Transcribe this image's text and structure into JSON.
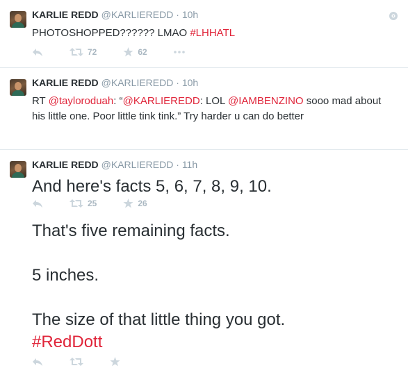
{
  "tweets": [
    {
      "name": "KARLIE REDD",
      "handle": "@KARLIEREDD",
      "separator": "·",
      "time": "10h",
      "text_before": "PHOTOSHOPPED?????? LMAO ",
      "hashtag": "#LHHATL",
      "retweets": "72",
      "favorites": "62"
    },
    {
      "name": "KARLIE REDD",
      "handle": "@KARLIEREDD",
      "separator": "·",
      "time": "10h",
      "prefix": "RT ",
      "mention1": "@tayloroduah",
      "part2": ": “",
      "mention2": "@KARLIEREDD",
      "part3": ": LOL ",
      "mention3": "@IAMBENZINO",
      "part4": " sooo mad about his little one. Poor little tink tink.” Try harder u can do better",
      "retweets": "25",
      "favorites": "26"
    },
    {
      "name": "KARLIE REDD",
      "handle": "@KARLIEREDD",
      "separator": "·",
      "time": "11h",
      "line1": "And here's facts 5, 6, 7, 8, 9, 10.",
      "line2": "That's five remaining facts.",
      "line3": "5 inches.",
      "line4": "The size of that little thing you got.",
      "hashtag": "#RedDott"
    }
  ],
  "icons": {
    "reply": "reply-icon",
    "retweet": "retweet-icon",
    "favorite": "star-icon",
    "more": "more-icon",
    "settings": "gear-icon"
  },
  "colors": {
    "link": "#e0253a",
    "meta": "#8899a6",
    "action": "#ccd6dd"
  }
}
